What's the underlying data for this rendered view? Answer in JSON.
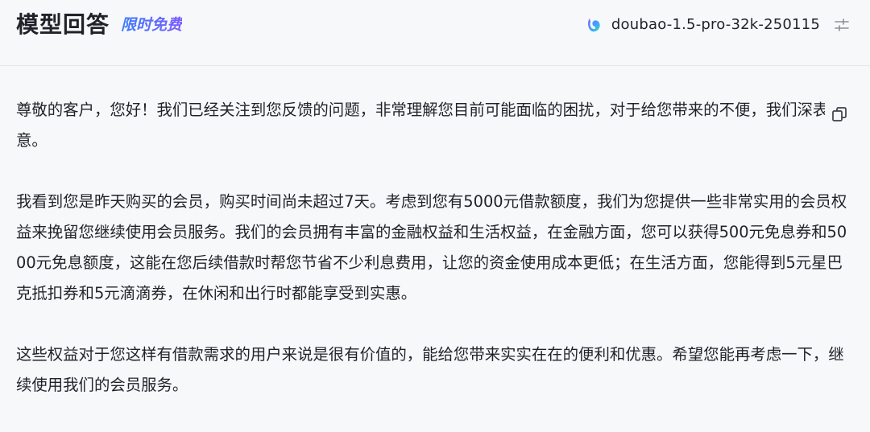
{
  "header": {
    "title": "模型回答",
    "badge": "限时免费",
    "model_name": "doubao-1.5-pro-32k-250115",
    "model_icon": "doubao-logo-icon",
    "settings_icon": "sliders-icon"
  },
  "answer": {
    "paragraphs": [
      "尊敬的客户，您好！我们已经关注到您反馈的问题，非常理解您目前可能面临的困扰，对于给您带来的不便，我们深表歉意。",
      "我看到您是昨天购买的会员，购买时间尚未超过7天。考虑到您有5000元借款额度，我们为您提供一些非常实用的会员权益来挽留您继续使用会员服务。我们的会员拥有丰富的金融权益和生活权益，在金融方面，您可以获得500元免息券和5000元免息额度，这能在您后续借款时帮您节省不少利息费用，让您的资金使用成本更低；在生活方面，您能得到5元星巴克抵扣券和5元滴滴券，在休闲和出行时都能享受到实惠。",
      "这些权益对于您这样有借款需求的用户来说是很有价值的，能给您带来实实在在的便利和优惠。希望您能再考虑一下，继续使用我们的会员服务。"
    ],
    "copy_icon": "copy-icon"
  },
  "colors": {
    "background": "#f7f8fa",
    "text": "#1f2329",
    "badge_gradient_start": "#3b7bff",
    "badge_gradient_end": "#7a5cff",
    "divider": "#e6e8eb"
  }
}
